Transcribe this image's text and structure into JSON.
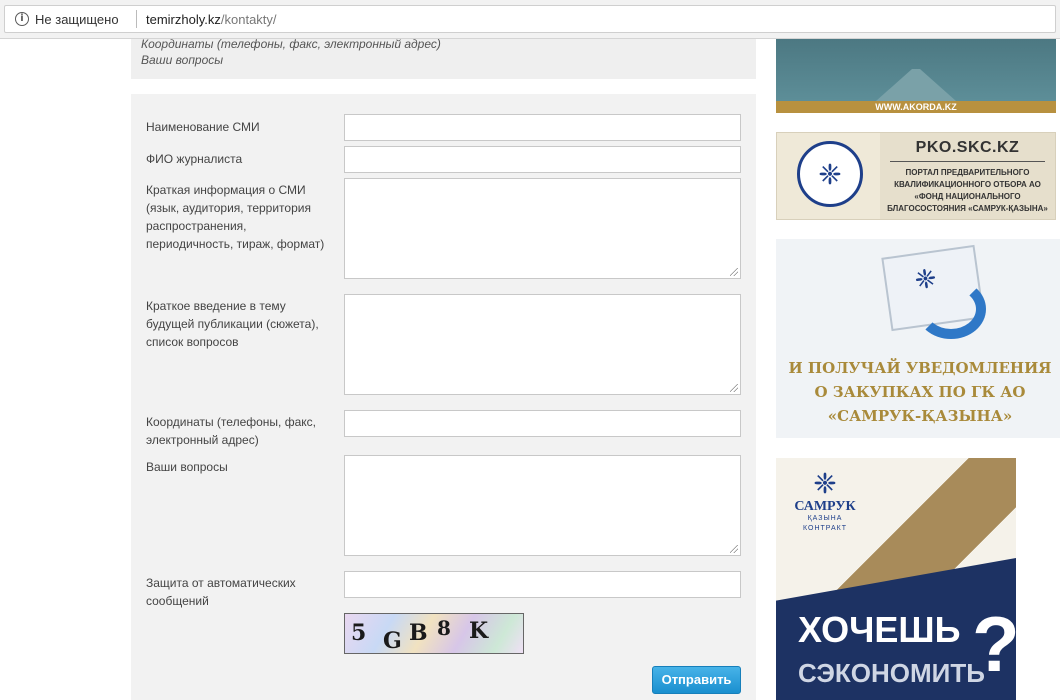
{
  "browser": {
    "security_label": "Не защищено",
    "url_domain": "temirzholy.kz",
    "url_path": "/kontakty/"
  },
  "intro": {
    "line1": "Координаты (телефоны, факс, электронный адрес)",
    "line2": "Ваши вопросы"
  },
  "form": {
    "media_name_label": "Наименование СМИ",
    "journalist_label": "ФИО журналиста",
    "media_info_label": "Краткая информация о СМИ (язык, аудитория, территория распространения, периодичность, тираж, формат)",
    "topic_label": "Краткое введение в тему будущей публикации (сюжета), список вопросов",
    "contacts_label": "Координаты (телефоны, факс, электронный адрес)",
    "questions_label": "Ваши вопросы",
    "captcha_label": "Защита от автоматических сообщений",
    "captcha_chars": [
      "5",
      "G",
      "B",
      "8",
      "K"
    ],
    "submit_label": "Отправить"
  },
  "banners": {
    "akorda": {
      "url": "WWW.AKORDA.KZ"
    },
    "pko": {
      "title": "PKO.SKC.KZ",
      "description": "ПОРТАЛ ПРЕДВАРИТЕЛЬНОГО КВАЛИФИКАЦИОННОГО ОТБОРА АО «ФОНД НАЦИОНАЛЬНОГО БЛАГОСОСТОЯНИЯ «САМРУК-ҚАЗЫНА»"
    },
    "notify": {
      "text": "И ПОЛУЧАЙ УВЕДОМЛЕНИЯ О ЗАКУПКАХ ПО ГК АО «САМРУК-ҚАЗЫНА»"
    },
    "samruk": {
      "logo_name": "САМРУК",
      "logo_sub": "ҚАЗЫНА",
      "logo_sub2": "КОНТРАКТ",
      "headline": "ХОЧЕШЬ",
      "subline": "СЭКОНОМИТЬ",
      "question_mark": "?"
    }
  },
  "colors": {
    "submit_button": "#2a9fdc",
    "banner_navy": "#1d3263",
    "banner_gold": "#a98a3a"
  }
}
